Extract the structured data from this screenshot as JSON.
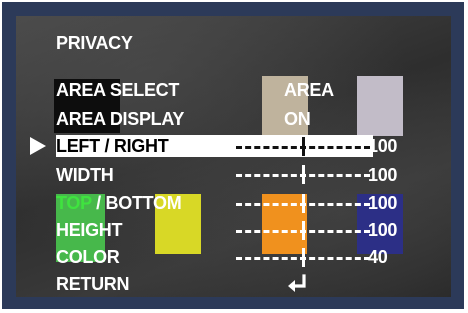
{
  "menu": {
    "title": "PRIVACY",
    "items": [
      {
        "label": "AREA SELECT",
        "value": "AREA"
      },
      {
        "label": "AREA DISPLAY",
        "value": "ON"
      },
      {
        "label": "LEFT / RIGHT",
        "value": "100",
        "level": 0.5
      },
      {
        "label": "WIDTH",
        "value": "100",
        "level": 0.5
      },
      {
        "label_part1": "TOP",
        "label_part2": " / BOTTOM",
        "value": "100",
        "level": 0.5
      },
      {
        "label": "HEIGHT",
        "value": "100",
        "level": 0.5
      },
      {
        "label": "COLOR",
        "value": "40",
        "level": 0.5
      },
      {
        "label": "RETURN",
        "icon": "enter-return-icon"
      }
    ],
    "selected_item": "LEFT / RIGHT",
    "selection_marker": "triangle-pointer-icon"
  },
  "colors": {
    "frame": "#2c3a59",
    "text": "#ffffff",
    "highlight_text": "#000000",
    "green_label": "#3fe33f",
    "mask_black": "#0d0d0d",
    "mask_green": "#47b84b",
    "mask_yellow": "#d8d826",
    "mask_tan": "#bfb39d",
    "mask_lilac": "#c2bcc8",
    "mask_orange": "#f0911e",
    "mask_navy": "#2c2f86"
  }
}
